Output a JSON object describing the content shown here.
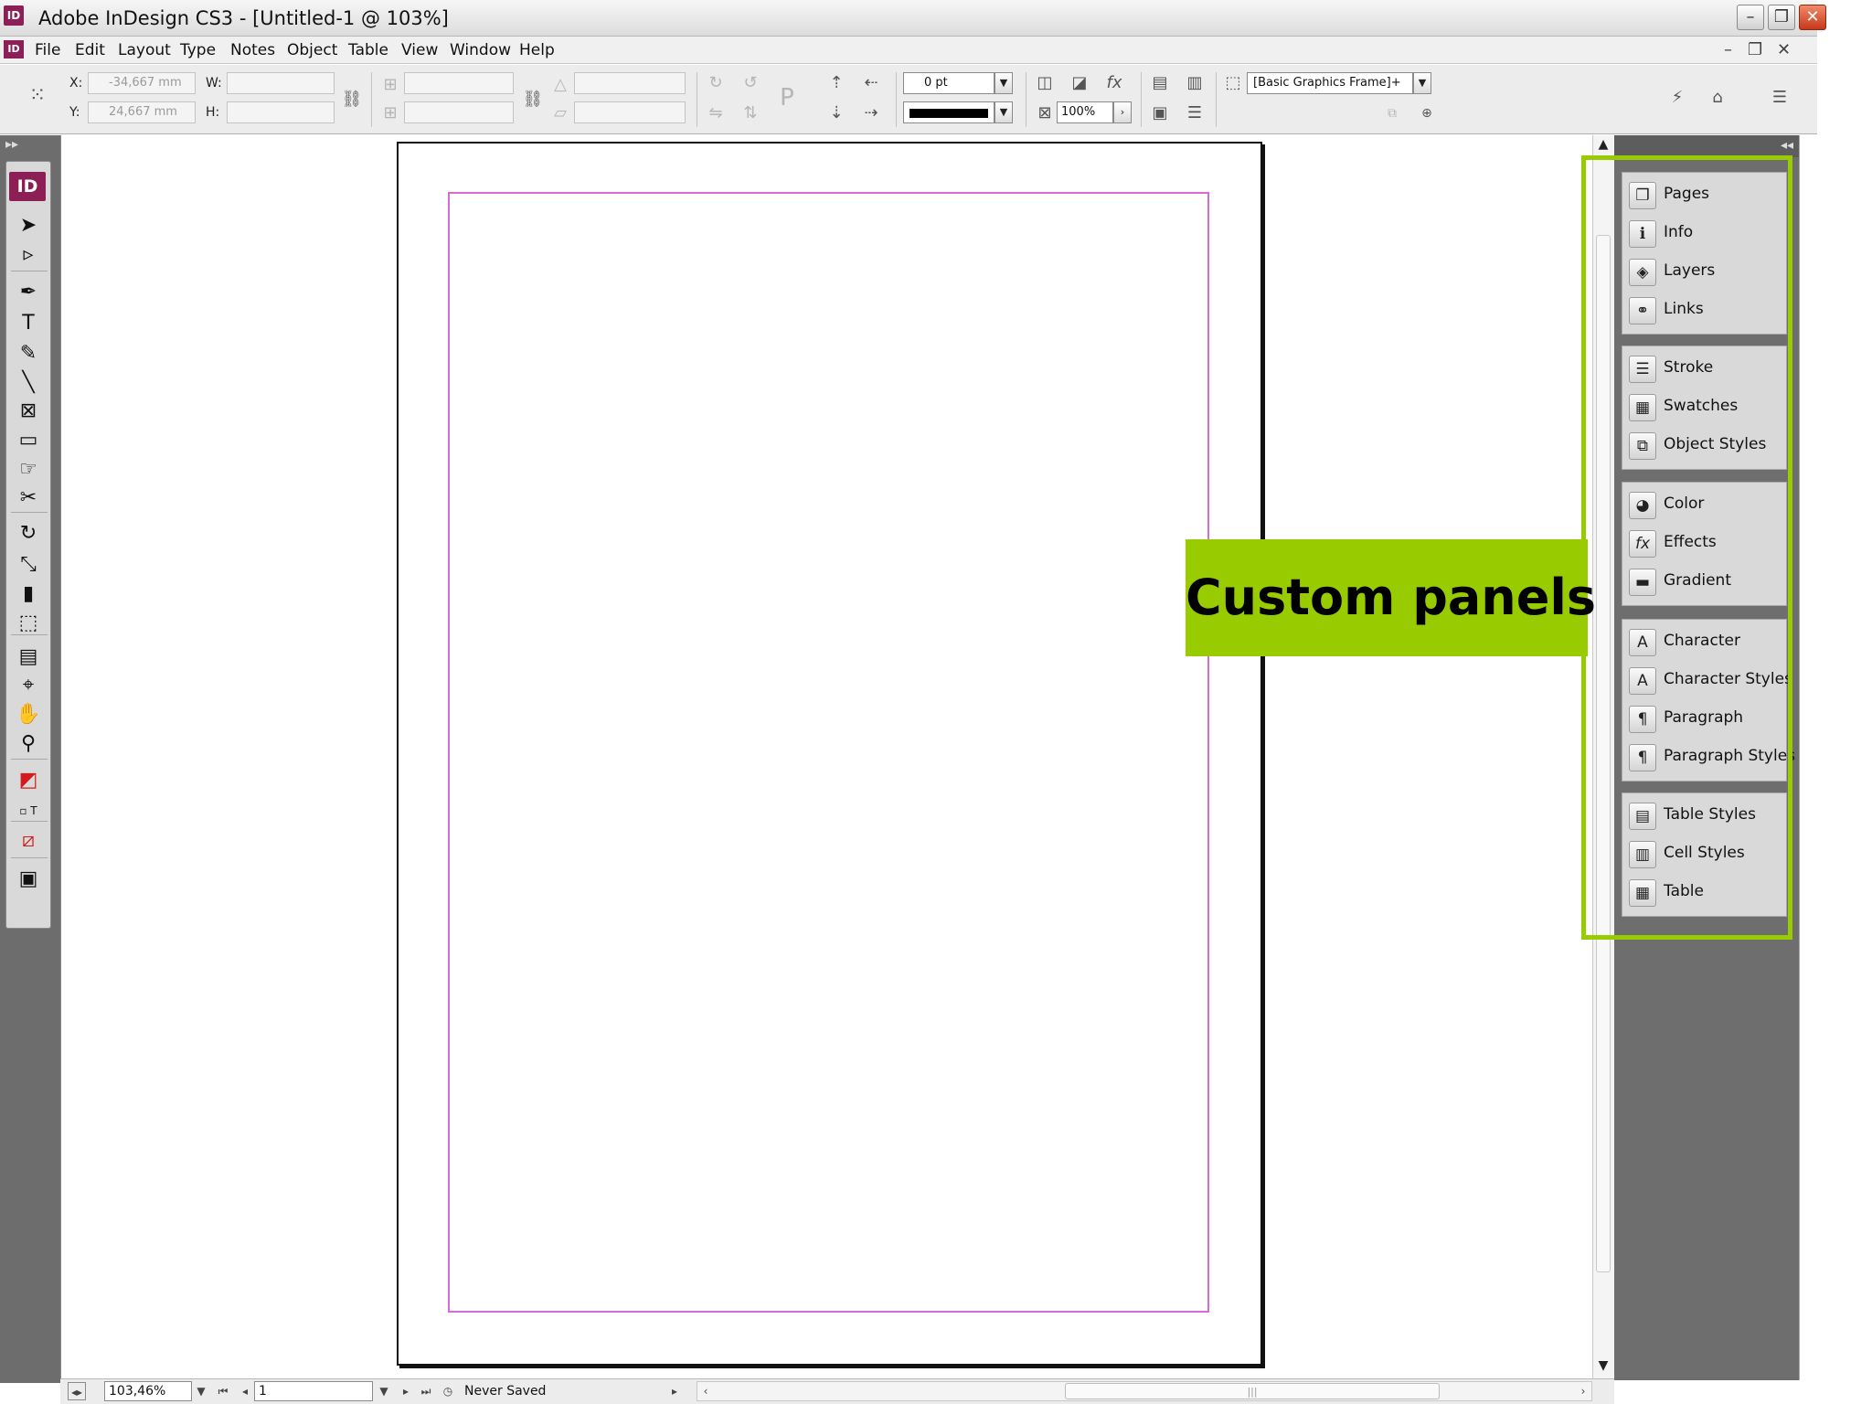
{
  "window": {
    "title": "Adobe InDesign CS3 - [Untitled-1 @ 103%]",
    "logo": "ID",
    "controls": {
      "minimize": "–",
      "restore": "❐",
      "close": "✕"
    }
  },
  "menubar": {
    "logo": "ID",
    "items": [
      "File",
      "Edit",
      "Layout",
      "Type",
      "Notes",
      "Object",
      "Table",
      "View",
      "Window",
      "Help"
    ],
    "doc_controls": {
      "minimize": "–",
      "restore": "❐",
      "close": "✕"
    }
  },
  "controlbar": {
    "x_label": "X:",
    "x_value": "-34,667 mm",
    "y_label": "Y:",
    "y_value": "24,667 mm",
    "w_label": "W:",
    "w_value": "",
    "h_label": "H:",
    "h_value": "",
    "stroke_weight": "0 pt",
    "opacity": "100%",
    "object_style": "[Basic Graphics Frame]+"
  },
  "tools": {
    "logo": "ID",
    "items": [
      {
        "name": "selection-tool-icon",
        "glyph": "➤"
      },
      {
        "name": "direct-selection-tool-icon",
        "glyph": "▹"
      },
      {
        "name": "pen-tool-icon",
        "glyph": "✒"
      },
      {
        "name": "type-tool-icon",
        "glyph": "T"
      },
      {
        "name": "pencil-tool-icon",
        "glyph": "✎"
      },
      {
        "name": "line-tool-icon",
        "glyph": "╲"
      },
      {
        "name": "rectangle-frame-tool-icon",
        "glyph": "⊠"
      },
      {
        "name": "rectangle-tool-icon",
        "glyph": "▭"
      },
      {
        "name": "button-tool-icon",
        "glyph": "☞"
      },
      {
        "name": "scissors-tool-icon",
        "glyph": "✂"
      },
      {
        "name": "rotate-tool-icon",
        "glyph": "↻"
      },
      {
        "name": "scale-tool-icon",
        "glyph": "⤡"
      },
      {
        "name": "gradient-tool-icon",
        "glyph": "▮"
      },
      {
        "name": "free-transform-tool-icon",
        "glyph": "⬚"
      },
      {
        "name": "note-tool-icon",
        "glyph": "▤"
      },
      {
        "name": "eyedropper-tool-icon",
        "glyph": "⌖"
      },
      {
        "name": "hand-tool-icon",
        "glyph": "✋"
      },
      {
        "name": "zoom-tool-icon",
        "glyph": "⚲"
      },
      {
        "name": "fill-stroke-icon",
        "glyph": "◩"
      },
      {
        "name": "formatting-affects-icon",
        "glyph": "▫ T"
      },
      {
        "name": "apply-none-icon",
        "glyph": "⧄"
      },
      {
        "name": "view-mode-icon",
        "glyph": "▣"
      }
    ]
  },
  "panels": {
    "groups": [
      [
        {
          "label": "Pages",
          "icon": "pages-icon",
          "glyph": "❐"
        },
        {
          "label": "Info",
          "icon": "info-icon",
          "glyph": "ℹ"
        },
        {
          "label": "Layers",
          "icon": "layers-icon",
          "glyph": "◈"
        },
        {
          "label": "Links",
          "icon": "links-icon",
          "glyph": "⚭"
        }
      ],
      [
        {
          "label": "Stroke",
          "icon": "stroke-icon",
          "glyph": "☰"
        },
        {
          "label": "Swatches",
          "icon": "swatches-icon",
          "glyph": "▦"
        },
        {
          "label": "Object Styles",
          "icon": "object-styles-icon",
          "glyph": "⧉"
        }
      ],
      [
        {
          "label": "Color",
          "icon": "color-icon",
          "glyph": "◕"
        },
        {
          "label": "Effects",
          "icon": "effects-icon",
          "glyph": "fx"
        },
        {
          "label": "Gradient",
          "icon": "gradient-icon",
          "glyph": "▬"
        }
      ],
      [
        {
          "label": "Character",
          "icon": "character-icon",
          "glyph": "A"
        },
        {
          "label": "Character Styles",
          "icon": "character-styles-icon",
          "glyph": "A"
        },
        {
          "label": "Paragraph",
          "icon": "paragraph-icon",
          "glyph": "¶"
        },
        {
          "label": "Paragraph Styles",
          "icon": "paragraph-styles-icon",
          "glyph": "¶"
        }
      ],
      [
        {
          "label": "Table Styles",
          "icon": "table-styles-icon",
          "glyph": "▤"
        },
        {
          "label": "Cell Styles",
          "icon": "cell-styles-icon",
          "glyph": "▥"
        },
        {
          "label": "Table",
          "icon": "table-icon",
          "glyph": "▦"
        }
      ]
    ]
  },
  "callout": {
    "text": "Custom panels",
    "color": "#99cc00"
  },
  "statusbar": {
    "zoom": "103,46%",
    "page": "1",
    "save_status": "Never Saved"
  },
  "colors": {
    "accent": "#99cc00",
    "margin_guide": "#d76ad6",
    "app_brand": "#8c1f55"
  }
}
